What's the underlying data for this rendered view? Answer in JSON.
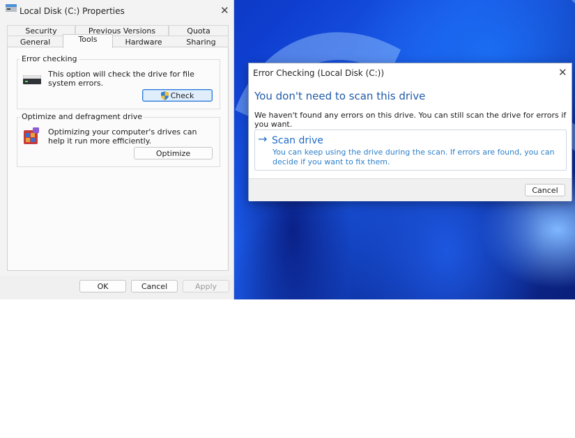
{
  "properties_window": {
    "title": "Local Disk (C:) Properties",
    "tabs_row1": [
      {
        "label": "Security"
      },
      {
        "label": "Previous Versions"
      },
      {
        "label": "Quota"
      }
    ],
    "tabs_row2": [
      {
        "label": "General"
      },
      {
        "label": "Tools",
        "active": true
      },
      {
        "label": "Hardware"
      },
      {
        "label": "Sharing"
      }
    ],
    "error_checking": {
      "legend": "Error checking",
      "description": "This option will check the drive for file system errors.",
      "check_button": "Check",
      "icon": "drive-icon",
      "button_icon": "shield-icon"
    },
    "optimize": {
      "legend": "Optimize and defragment drive",
      "description": "Optimizing your computer's drives can help it run more efficiently.",
      "optimize_button": "Optimize",
      "icon": "defrag-icon"
    },
    "footer": {
      "ok": "OK",
      "cancel": "Cancel",
      "apply": "Apply"
    }
  },
  "error_dialog": {
    "title": "Error Checking (Local Disk (C:))",
    "heading": "You don't need to scan this drive",
    "message": "We haven't found any errors on this drive. You can still scan the drive for errors if you want.",
    "command": {
      "arrow": "→",
      "title": "Scan drive",
      "note": "You can keep using the drive during the scan. If errors are found, you can decide if you want to fix them."
    },
    "cancel": "Cancel"
  },
  "colors": {
    "heading_blue": "#1e5aa8",
    "link_blue": "#1e6bc4",
    "focus_blue": "#2d7bd6",
    "wallpaper_blue": "#0f3fd0"
  }
}
